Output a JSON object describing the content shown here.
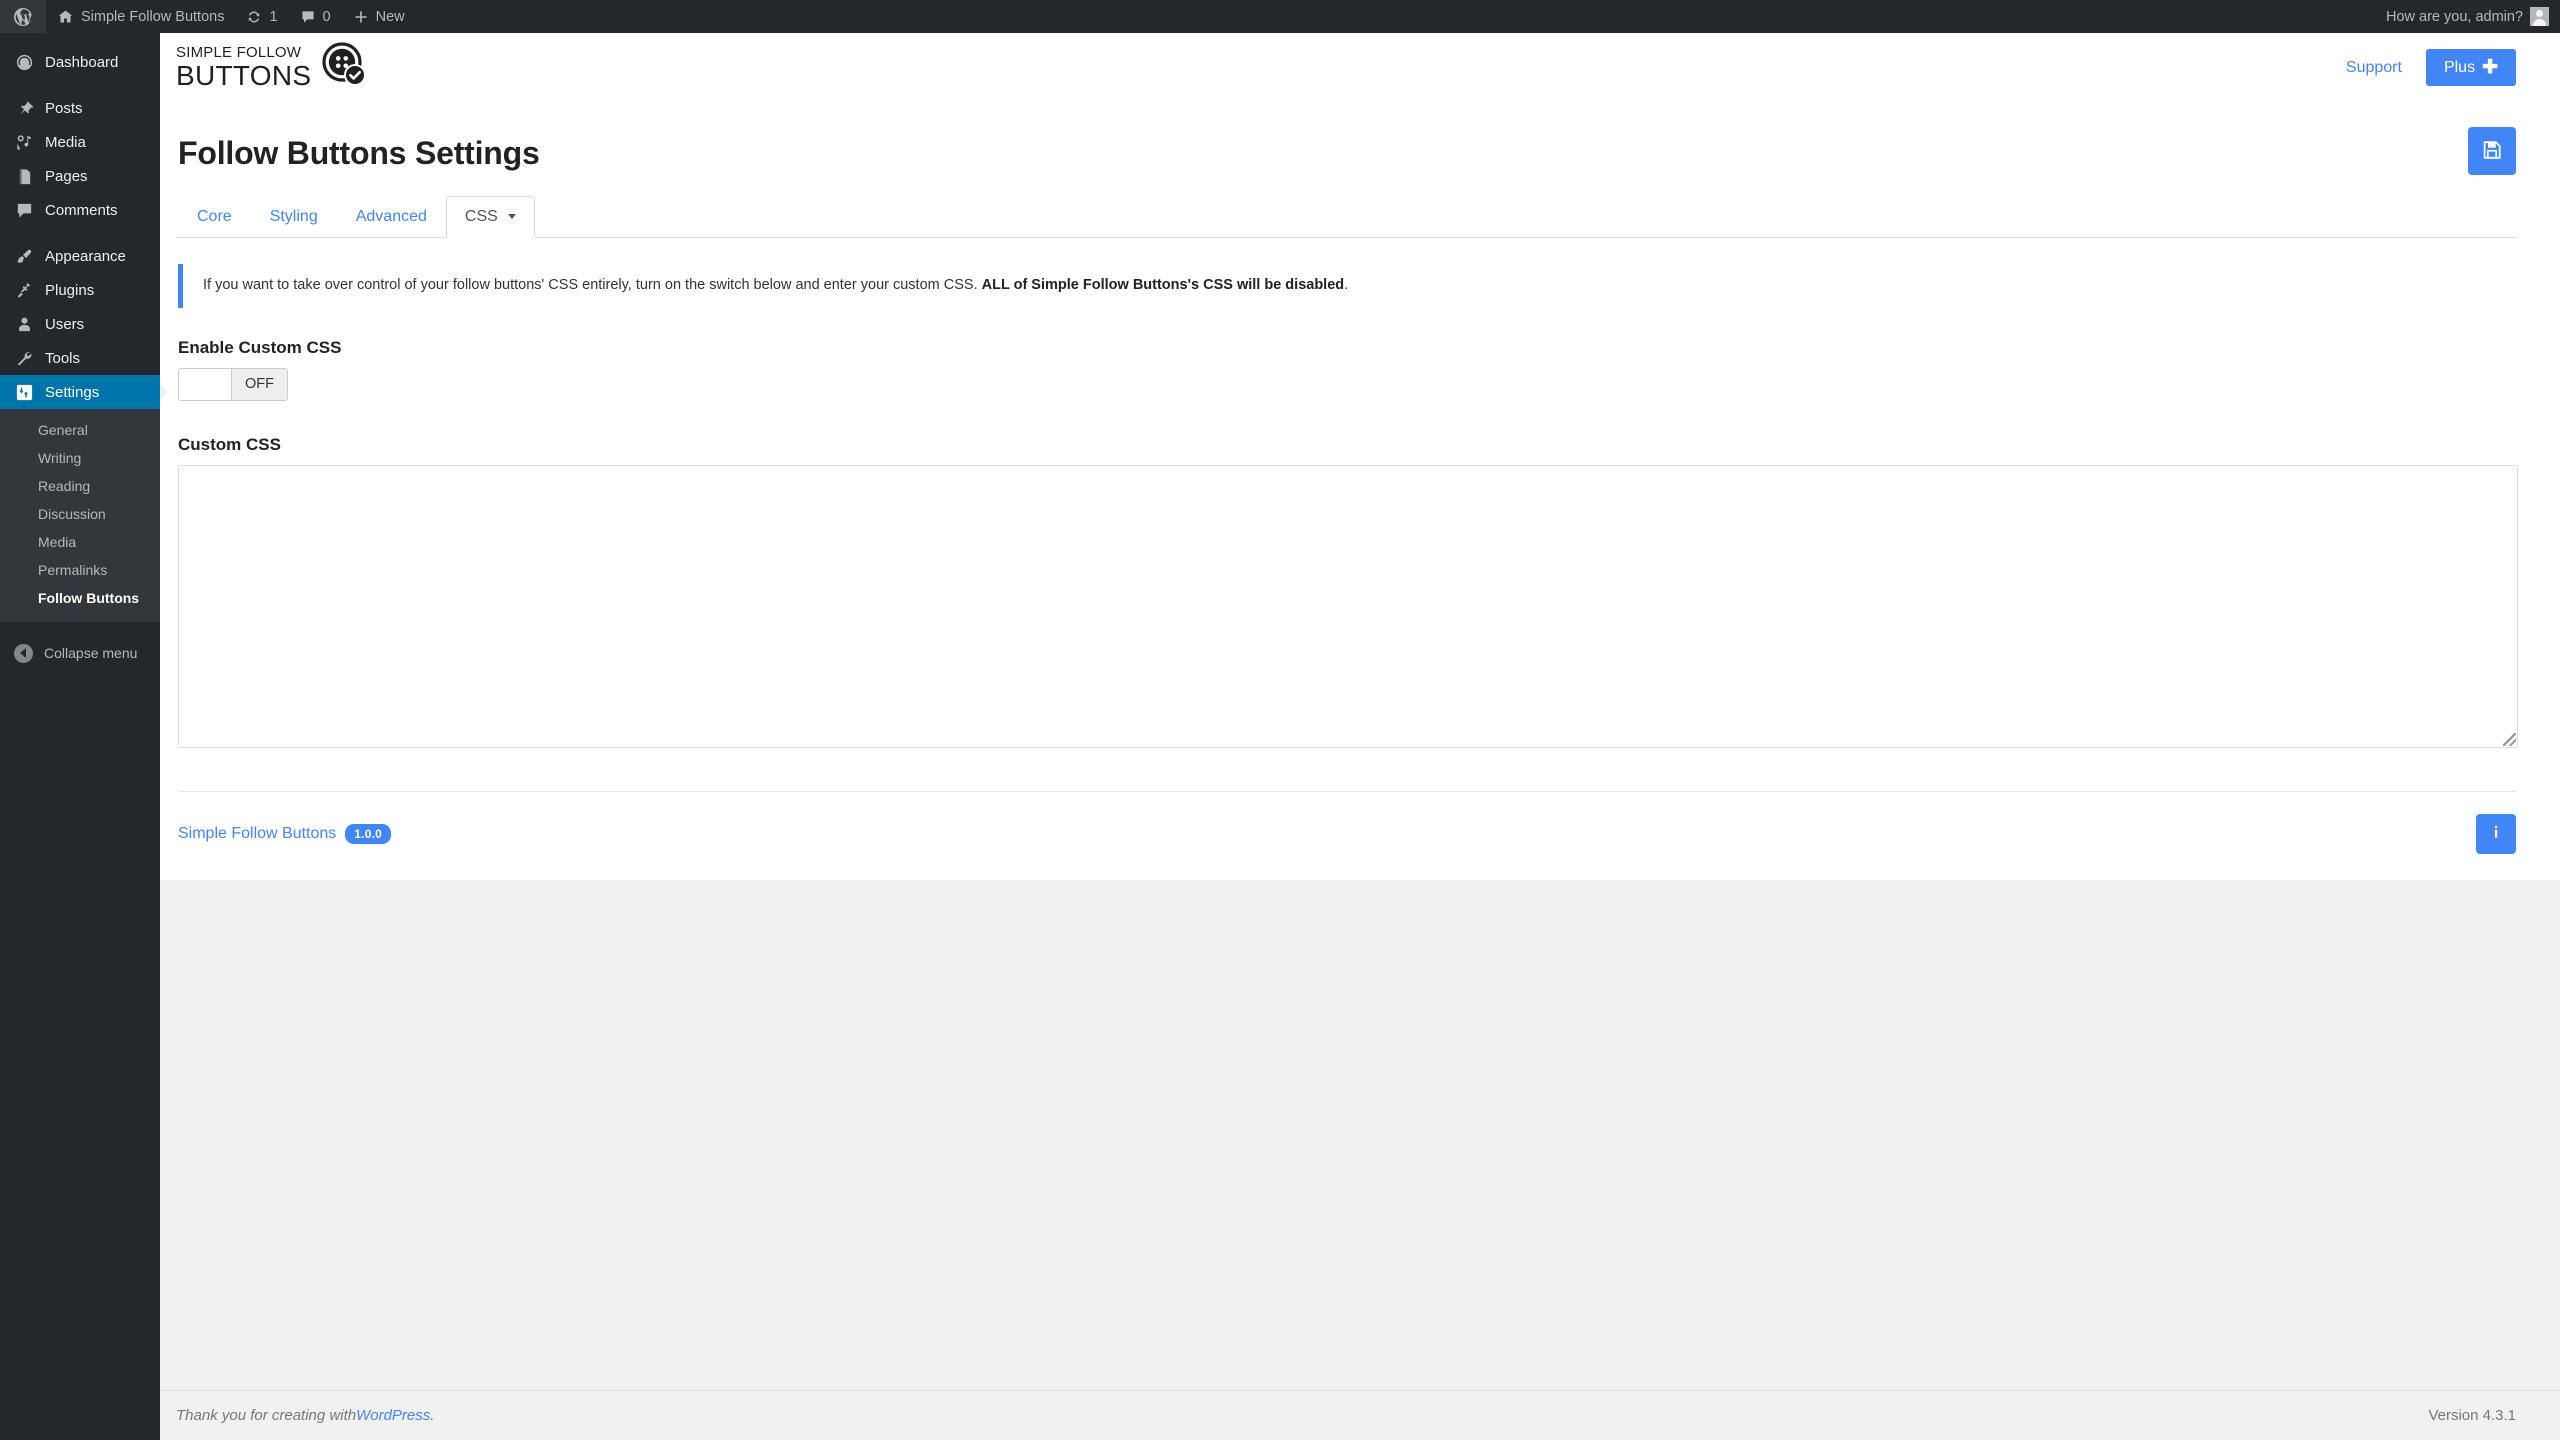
{
  "adminbar": {
    "site_name": "Simple Follow Buttons",
    "updates_count": "1",
    "comments_count": "0",
    "new_label": "New",
    "howdy": "How are you, admin?"
  },
  "sidebar": {
    "items": [
      {
        "label": "Dashboard",
        "icon": "dashboard-icon"
      },
      {
        "label": "Posts",
        "icon": "pin-icon"
      },
      {
        "label": "Media",
        "icon": "media-icon"
      },
      {
        "label": "Pages",
        "icon": "pages-icon"
      },
      {
        "label": "Comments",
        "icon": "comment-icon"
      },
      {
        "label": "Appearance",
        "icon": "brush-icon"
      },
      {
        "label": "Plugins",
        "icon": "plug-icon"
      },
      {
        "label": "Users",
        "icon": "user-icon"
      },
      {
        "label": "Tools",
        "icon": "wrench-icon"
      },
      {
        "label": "Settings",
        "icon": "settings-icon"
      }
    ],
    "submenu": [
      {
        "label": "General"
      },
      {
        "label": "Writing"
      },
      {
        "label": "Reading"
      },
      {
        "label": "Discussion"
      },
      {
        "label": "Media"
      },
      {
        "label": "Permalinks"
      },
      {
        "label": "Follow Buttons"
      }
    ],
    "collapse_label": "Collapse menu"
  },
  "plugin_header": {
    "brand_line1": "SIMPLE FOLLOW",
    "brand_line2": "BUTTONS",
    "support_label": "Support",
    "plus_label": "Plus",
    "plus_glyph": "✚"
  },
  "page": {
    "title": "Follow Buttons Settings",
    "save_icon": "save-floppy-icon"
  },
  "tabs": [
    {
      "label": "Core",
      "active": false
    },
    {
      "label": "Styling",
      "active": false
    },
    {
      "label": "Advanced",
      "active": false
    },
    {
      "label": "CSS",
      "active": true,
      "has_caret": true
    }
  ],
  "notice": {
    "text_before": "If you want to take over control of your follow buttons' CSS entirely, turn on the switch below and enter your custom CSS. ",
    "text_bold": "ALL of Simple Follow Buttons's CSS will be disabled",
    "text_after": "."
  },
  "fields": {
    "enable_css_label": "Enable Custom CSS",
    "toggle_state": "OFF",
    "custom_css_label": "Custom CSS",
    "custom_css_value": "",
    "custom_css_placeholder": ""
  },
  "plugin_footer": {
    "name": "Simple Follow Buttons",
    "version_badge": "1.0.0",
    "info_icon": "info-icon"
  },
  "wp_footer": {
    "thanks_text": "Thank you for creating with ",
    "wordpress_link": "WordPress",
    "thanks_suffix": ".",
    "version": "Version 4.3.1"
  },
  "colors": {
    "accent": "#4285f4",
    "admin_dark": "#23282d",
    "admin_submenu": "#32373c",
    "current_blue": "#0073aa"
  }
}
